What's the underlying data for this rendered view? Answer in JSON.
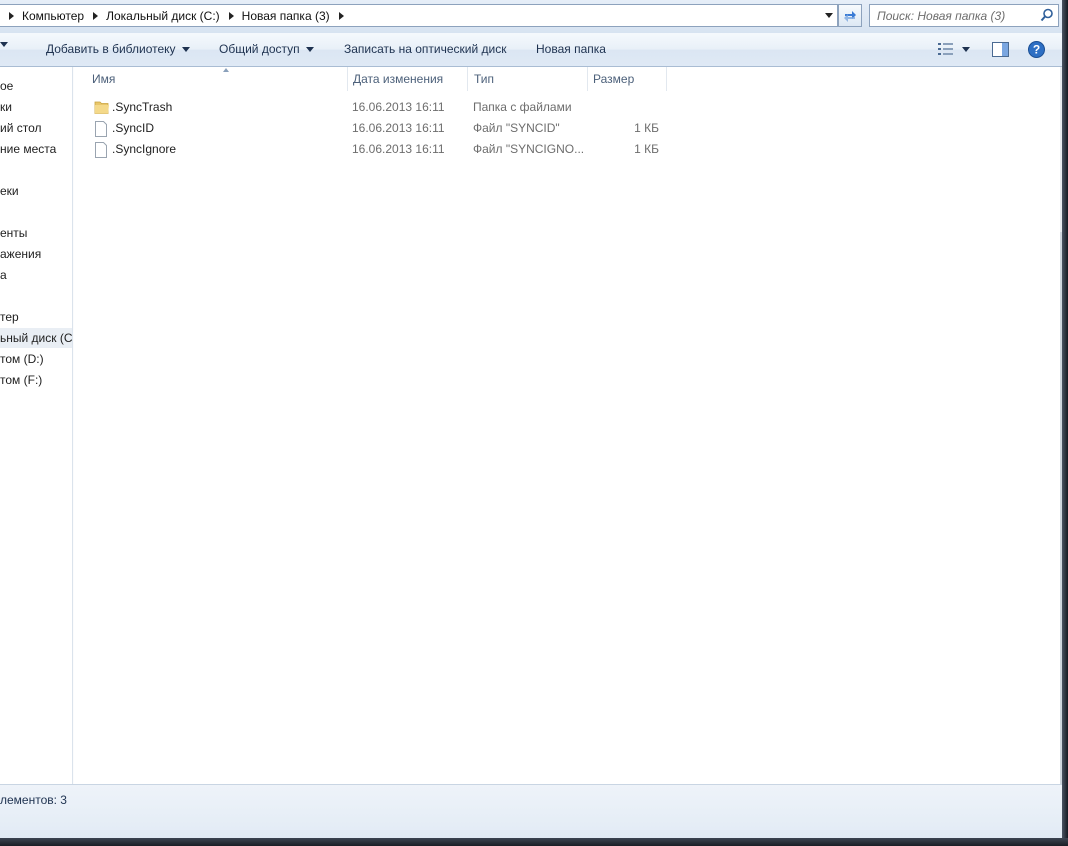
{
  "address_bar": {
    "breadcrumbs": [
      "Компьютер",
      "Локальный диск (C:)",
      "Новая папка (3)"
    ]
  },
  "search": {
    "placeholder": "Поиск: Новая папка (3)"
  },
  "toolbar": {
    "add_to_library": "Добавить в библиотеку",
    "share": "Общий доступ",
    "burn": "Записать на оптический диск",
    "new_folder": "Новая папка"
  },
  "nav_pane": {
    "items": [
      "ое",
      "ки",
      "ий стол",
      "ние места",
      "еки",
      "енты",
      "ажения",
      "а",
      "тер",
      "ьный диск (C:",
      " том (D:)",
      " том (F:)"
    ]
  },
  "columns": {
    "name": "Имя",
    "date": "Дата изменения",
    "type": "Тип",
    "size": "Размер"
  },
  "files": [
    {
      "name": ".SyncTrash",
      "date": "16.06.2013 16:11",
      "type": "Папка с файлами",
      "size": "",
      "icon": "folder-icon"
    },
    {
      "name": ".SyncID",
      "date": "16.06.2013 16:11",
      "type": "Файл \"SYNCID\"",
      "size": "1 КБ",
      "icon": "file-icon"
    },
    {
      "name": ".SyncIgnore",
      "date": "16.06.2013 16:11",
      "type": "Файл \"SYNCIGNO...",
      "size": "1 КБ",
      "icon": "file-icon"
    }
  ],
  "status_bar": {
    "text": "лементов: 3"
  },
  "colors": {
    "toolbar_text": "#1e3250",
    "column_header": "#4c607a",
    "secondary_text": "#6d6d6d"
  }
}
